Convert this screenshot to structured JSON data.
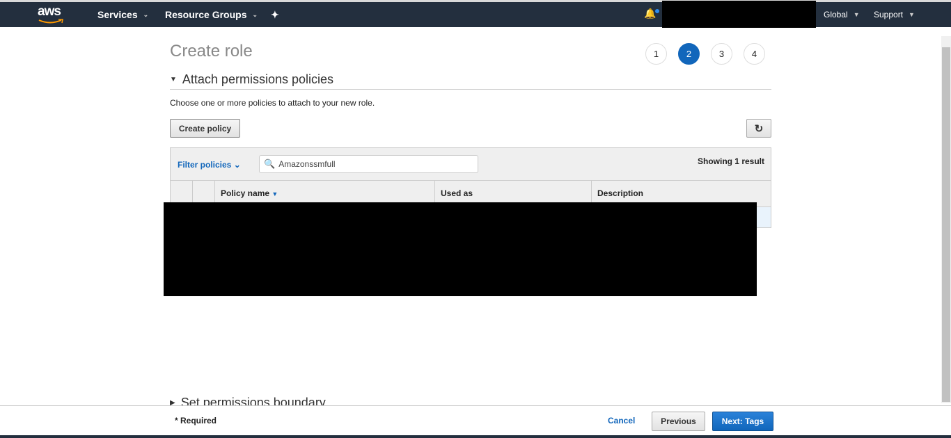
{
  "nav": {
    "logo": "aws",
    "services": "Services",
    "resource_groups": "Resource Groups",
    "region": "Global",
    "support": "Support"
  },
  "page": {
    "title": "Create role",
    "steps": [
      "1",
      "2",
      "3",
      "4"
    ],
    "active_step": "2",
    "section": "Attach permissions policies",
    "description": "Choose one or more policies to attach to your new role.",
    "create_policy": "Create policy",
    "filter": "Filter policies",
    "search_value": "Amazonssmfull",
    "showing": "Showing 1 result",
    "columns": [
      "Policy name",
      "Used as",
      "Description"
    ],
    "boundary": "Set permissions boundary"
  },
  "footer": {
    "required": "* Required",
    "cancel": "Cancel",
    "previous": "Previous",
    "next": "Next: Tags"
  },
  "colors": {
    "nav": "#232f3e",
    "accent": "#1166bb"
  }
}
